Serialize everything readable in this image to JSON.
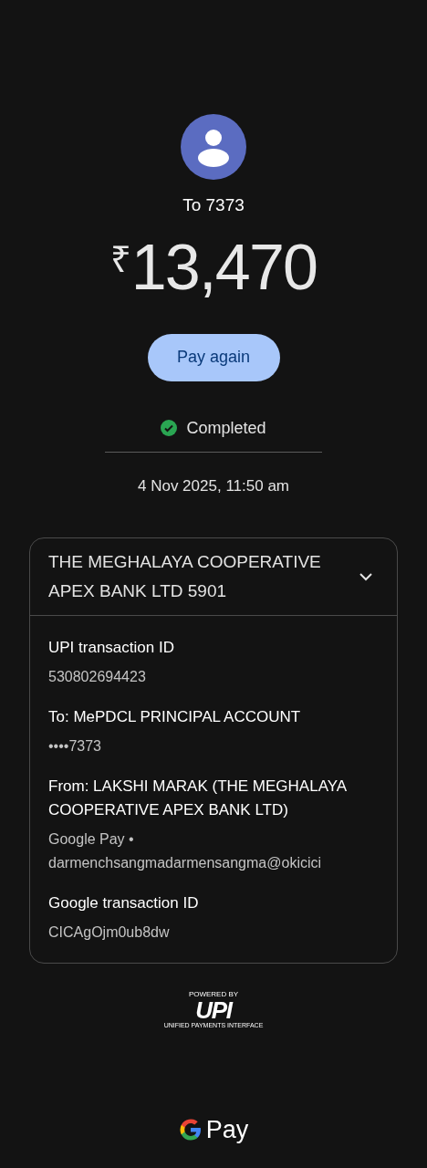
{
  "recipient": {
    "label": "To 7373"
  },
  "amount": {
    "currency": "₹",
    "value": "13,470"
  },
  "pay_again_button": {
    "label": "Pay again"
  },
  "status": {
    "label": "Completed",
    "kind": "success"
  },
  "date": "4 Nov 2025, 11:50 am",
  "account_card": {
    "title": "THE MEGHALAYA COOPERATIVE APEX BANK LTD 5901",
    "expanded": true,
    "details": [
      {
        "label": "UPI transaction ID",
        "lines": [
          "530802694423"
        ]
      },
      {
        "label": "To: MePDCL PRINCIPAL ACCOUNT",
        "lines": [
          "••••7373"
        ]
      },
      {
        "label": "From: LAKSHI MARAK (THE MEGHALAYA COOPERATIVE APEX BANK LTD)",
        "lines": [
          "Google Pay •",
          "darmenchsangmadarmensangma@okicici"
        ]
      },
      {
        "label": "Google transaction ID",
        "lines": [
          "CICAgOjm0ub8dw"
        ]
      }
    ]
  },
  "upi_badge": {
    "caption": "POWERED BY",
    "logo": "UPI",
    "tagline": "UNIFIED PAYMENTS INTERFACE"
  },
  "footer_brand": {
    "text": "Pay"
  }
}
